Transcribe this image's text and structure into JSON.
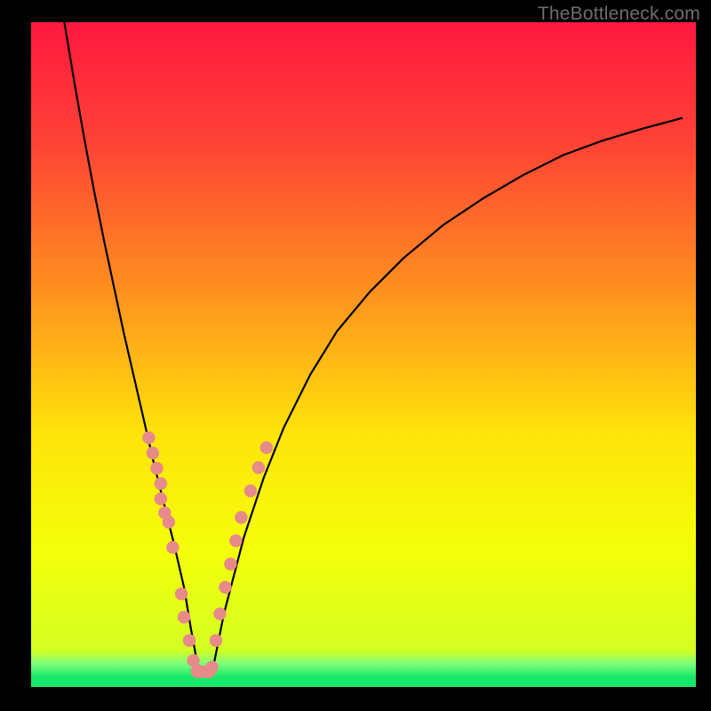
{
  "watermark": "TheBottleneck.com",
  "chart_data": {
    "type": "line",
    "title": "",
    "xlabel": "",
    "ylabel": "",
    "xlim": [
      0,
      100
    ],
    "ylim": [
      0,
      100
    ],
    "grid": false,
    "legend": false,
    "gradient_stops": [
      {
        "offset": 0.0,
        "color": "#ff183f"
      },
      {
        "offset": 0.18,
        "color": "#ff4236"
      },
      {
        "offset": 0.4,
        "color": "#ff8f1f"
      },
      {
        "offset": 0.62,
        "color": "#ffe40a"
      },
      {
        "offset": 0.8,
        "color": "#f3ff0a"
      },
      {
        "offset": 0.945,
        "color": "#d4ff22"
      },
      {
        "offset": 0.965,
        "color": "#7dff7a"
      },
      {
        "offset": 0.985,
        "color": "#17e86a"
      },
      {
        "offset": 1.0,
        "color": "#17e86a"
      }
    ],
    "series": [
      {
        "name": "bottleneck-curve",
        "type": "line",
        "color": "#000000",
        "x": [
          5.0,
          6.5,
          8.0,
          9.5,
          11.0,
          12.5,
          14.0,
          15.5,
          17.0,
          18.5,
          20.0,
          21.5,
          23.0,
          24.0,
          25.0,
          26.0,
          27.5,
          29.0,
          32.0,
          35.0,
          38.0,
          42.0,
          46.0,
          51.0,
          56.0,
          62.0,
          68.0,
          74.0,
          80.0,
          86.0,
          92.0,
          98.0
        ],
        "y": [
          100.0,
          91.0,
          82.5,
          74.5,
          67.0,
          60.0,
          53.0,
          46.5,
          40.0,
          33.5,
          27.5,
          21.5,
          15.0,
          9.0,
          3.5,
          2.0,
          3.5,
          11.0,
          22.5,
          31.5,
          39.0,
          47.0,
          53.5,
          59.5,
          64.5,
          69.5,
          73.5,
          77.0,
          80.0,
          82.2,
          84.0,
          85.6
        ]
      },
      {
        "name": "left-dots",
        "type": "scatter",
        "color": "#e78a8a",
        "x": [
          17.7,
          18.3,
          18.9,
          19.5,
          19.5,
          20.1,
          20.7,
          21.3,
          22.6,
          23.0,
          23.8,
          24.4,
          25.0
        ],
        "y": [
          37.5,
          35.2,
          32.9,
          30.6,
          28.3,
          26.2,
          24.8,
          21.0,
          14.0,
          10.5,
          7.0,
          4.0,
          2.5
        ]
      },
      {
        "name": "right-dots",
        "type": "scatter",
        "color": "#e78a8a",
        "x": [
          27.2,
          27.8,
          28.4,
          29.2,
          30.0,
          30.8,
          31.6,
          33.0,
          34.2,
          35.4
        ],
        "y": [
          3.0,
          7.0,
          11.0,
          15.0,
          18.5,
          22.0,
          25.5,
          29.5,
          33.0,
          36.0
        ]
      },
      {
        "name": "bottom-dots",
        "type": "scatter",
        "color": "#e78a8a",
        "x": [
          25.0,
          25.6,
          26.2,
          26.8
        ],
        "y": [
          2.3,
          2.3,
          2.3,
          2.3
        ]
      }
    ]
  }
}
